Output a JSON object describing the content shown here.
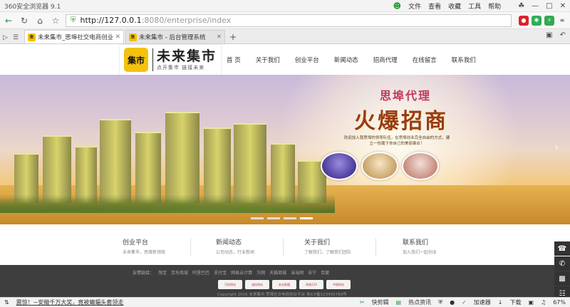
{
  "browser": {
    "title": "360安全浏览器 9.1",
    "menus": [
      "文件",
      "查看",
      "收藏",
      "工具",
      "帮助"
    ],
    "address_host": "http://127.0.0.1",
    "address_path": ":8080/enterprise/index",
    "tabs": [
      {
        "label": "未来集市_思埠社交电商创业平台",
        "active": true
      },
      {
        "label": "未来集市 - 后台管理系统",
        "active": false
      }
    ],
    "zoom": "67%"
  },
  "site": {
    "logo_mark": "集市",
    "logo_title": "未来集市",
    "logo_slogan": "点开集市  链接未来",
    "nav": [
      "首 页",
      "关于我们",
      "创业平台",
      "新闻动态",
      "招商代理",
      "在线留言",
      "联系我们"
    ],
    "banner": {
      "heading_small": "思埠代理",
      "heading_big": "火爆招商",
      "desc": "欢迎加入我思埠的领导队伍，在思埠创业完全自由的方式，建立一份属于你自己的美丽事业！"
    },
    "features": [
      {
        "title": "创业平台",
        "sub": "未来集市，思维新领商"
      },
      {
        "title": "新闻动态",
        "sub": "公司动态，行业新闻"
      },
      {
        "title": "关于我们",
        "sub": "了解我们，了解我们团队"
      },
      {
        "title": "联系我们",
        "sub": "加入我们一起创业"
      }
    ],
    "footer": {
      "links_label": "友情链接：",
      "links": [
        "淘宝",
        "京东商城",
        "阿里巴巴",
        "支付宝",
        "网易云计算",
        "万网",
        "天猫商城",
        "当当网",
        "苏宁",
        "百度"
      ],
      "badges": [
        "可信网站",
        "诚信网站",
        "安全联盟",
        "网络110",
        "中国网站"
      ],
      "copyright": "Copyright 2016 未来集市  思埠社交电商创业平台 粤ICP备123456789号"
    }
  },
  "status": {
    "news": "震惊！~安徽千万大奖，竟被蝙蝠头套领走",
    "items": [
      "快剪辑",
      "热点资讯",
      "加速器",
      "下载"
    ]
  }
}
